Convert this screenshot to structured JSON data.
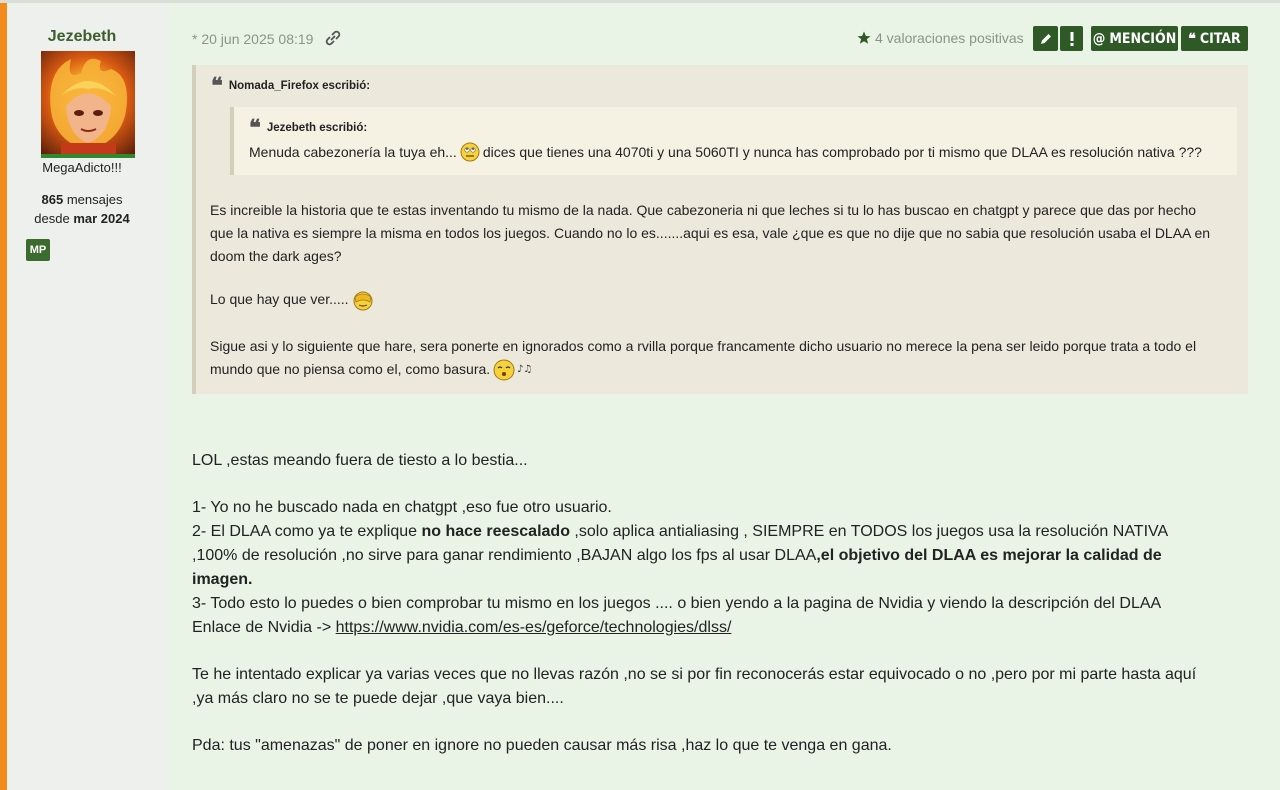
{
  "user": {
    "username": "Jezebeth",
    "title": "MegaAdicto!!!",
    "post_count": "865",
    "post_count_suffix": " mensajes",
    "since_prefix": "desde ",
    "since_date": "mar 2024",
    "badge": "MP",
    "accent_color": "#f28a1c"
  },
  "post": {
    "date": "* 20 jun 2025 08:19",
    "reactions_text": "4 valoraciones positivas",
    "buttons": {
      "mention": "MENCIÓN",
      "quote": "CITAR"
    },
    "icons": [
      "link-icon",
      "star-icon",
      "pencil-icon",
      "exclamation-icon",
      "at-icon",
      "quote-icon"
    ]
  },
  "quote": {
    "author": "Nomada_Firefox escribió:",
    "inner_author": "Jezebeth escribió:",
    "inner_text_before": "Menuda cabezonería la tuya eh...",
    "inner_text_after": "dices que tienes una 4070ti y una 5060TI y nunca has comprobado por ti mismo que DLAA es resolución nativa ???",
    "p1_l1": "Es increible la historia que te estas inventando tu mismo de la nada. Que cabezoneria ni que leches si tu lo has buscao en chatgpt y parece que das por hecho",
    "p1_l2": "que la nativa es siempre la misma en todos los juegos. Cuando no lo es.......aqui es esa, vale ¿que es que no dije que no sabia que resolución usaba el DLAA en",
    "p1_l3": "doom the dark ages?",
    "p2": "Lo que hay que ver.....",
    "p3_l1": "Sigue asi y lo siguiente que hare, sera ponerte en ignorados como a rvilla porque francamente dicho usuario no merece la pena ser leido porque trata a todo el",
    "p3_l2": "mundo que no piensa como el, como basura."
  },
  "body": {
    "p1": "LOL ,estas meando fuera de tiesto a lo bestia...",
    "item1": "1- Yo no he buscado nada en chatgpt ,eso fue otro usuario.",
    "item2_a": "2- El DLAA como ya te explique ",
    "item2_b": "no hace reescalado",
    "item2_c": " ,solo aplica antialiasing , SIEMPRE en TODOS los juegos usa la resolución NATIVA",
    "item2_d": ",100% de resolución ,no sirve para ganar rendimiento ,BAJAN algo los fps al usar DLAA",
    "item2_e": ",el objetivo del DLAA es mejorar la calidad de",
    "item2_f": "imagen.",
    "item3": "3- Todo esto lo puedes o bien comprobar tu mismo en los juegos .... o bien yendo a la pagina de Nvidia y viendo la descripción del DLAA",
    "link_prefix": "Enlace de Nvidia -> ",
    "link_url": "https://www.nvidia.com/es-es/geforce/technologies/dlss/",
    "p3_l1": "Te he intentado explicar ya varias veces que no llevas razón ,no se si por fin reconocerás estar equivocado o no ,pero por mi parte hasta aquí",
    "p3_l2": ",ya más claro no se te puede dejar ,que vaya bien....",
    "p4": "Pda: tus \"amenazas\" de poner en ignore no pueden causar más risa ,haz lo que te venga en gana."
  }
}
